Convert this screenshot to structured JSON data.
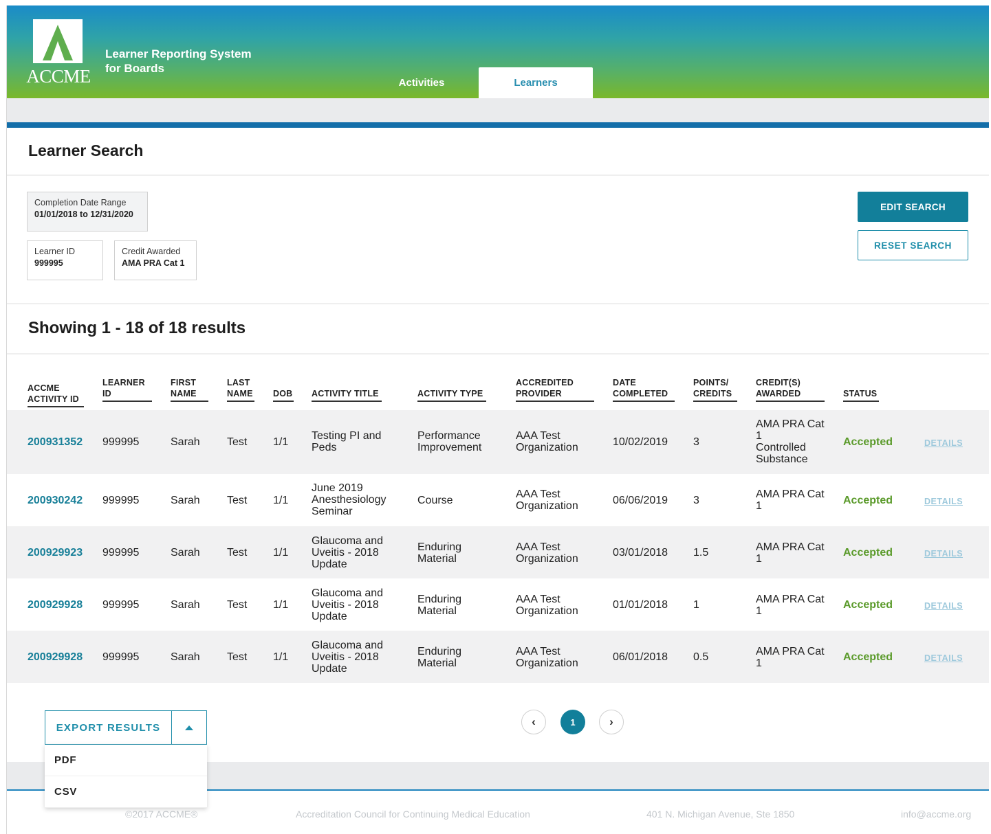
{
  "header": {
    "logo_text": "ACCME",
    "brand_line1": "Learner Reporting System",
    "brand_line2": "for Boards",
    "tabs": [
      {
        "label": "Activities"
      },
      {
        "label": "Learners"
      }
    ]
  },
  "page_title": "Learner Search",
  "filters": {
    "date_range_label": "Completion Date Range",
    "date_range_value": "01/01/2018 to 12/31/2020",
    "learner_id_label": "Learner ID",
    "learner_id_value": "999995",
    "credit_label": "Credit Awarded",
    "credit_value": "AMA PRA Cat 1"
  },
  "buttons": {
    "edit_search": "EDIT SEARCH",
    "reset_search": "RESET SEARCH"
  },
  "results_title": "Showing 1 - 18 of 18 results",
  "table": {
    "headers": {
      "accme_id_1": "ACCME",
      "accme_id_2": "ACTIVITY ID",
      "learner_id_1": "LEARNER",
      "learner_id_2": "ID",
      "first_1": "FIRST",
      "first_2": "NAME",
      "last_1": "LAST",
      "last_2": "NAME",
      "dob": "DOB",
      "title": "ACTIVITY TITLE",
      "type": "ACTIVITY TYPE",
      "provider_1": "ACCREDITED",
      "provider_2": "PROVIDER",
      "date_1": "DATE",
      "date_2": "COMPLETED",
      "points_1": "POINTS/",
      "points_2": "CREDITS",
      "credits_1": "CREDIT(S)",
      "credits_2": "AWARDED",
      "status": "STATUS"
    },
    "rows": [
      {
        "id": "200931352",
        "learner": "999995",
        "first": "Sarah",
        "last": "Test",
        "dob": "1/1",
        "title": [
          "Testing PI and",
          "Peds"
        ],
        "type": [
          "Performance",
          "Improvement"
        ],
        "provider": [
          "AAA Test",
          "Organization"
        ],
        "date": "10/02/2019",
        "points": "3",
        "credits": [
          "AMA PRA Cat",
          "1",
          "Controlled",
          "Substance"
        ],
        "status": "Accepted",
        "details": "DETAILS"
      },
      {
        "id": "200930242",
        "learner": "999995",
        "first": "Sarah",
        "last": "Test",
        "dob": "1/1",
        "title": [
          "June 2019",
          "Anesthesiology",
          "Seminar"
        ],
        "type": [
          "Course"
        ],
        "provider": [
          "AAA Test",
          "Organization"
        ],
        "date": "06/06/2019",
        "points": "3",
        "credits": [
          "AMA PRA Cat",
          "1"
        ],
        "status": "Accepted",
        "details": "DETAILS"
      },
      {
        "id": "200929923",
        "learner": "999995",
        "first": "Sarah",
        "last": "Test",
        "dob": "1/1",
        "title": [
          "Glaucoma and",
          "Uveitis - 2018",
          "Update"
        ],
        "type": [
          "Enduring",
          "Material"
        ],
        "provider": [
          "AAA Test",
          "Organization"
        ],
        "date": "03/01/2018",
        "points": "1.5",
        "credits": [
          "AMA PRA Cat",
          "1"
        ],
        "status": "Accepted",
        "details": "DETAILS"
      },
      {
        "id": "200929928",
        "learner": "999995",
        "first": "Sarah",
        "last": "Test",
        "dob": "1/1",
        "title": [
          "Glaucoma and",
          "Uveitis - 2018",
          "Update"
        ],
        "type": [
          "Enduring",
          "Material"
        ],
        "provider": [
          "AAA Test",
          "Organization"
        ],
        "date": "01/01/2018",
        "points": "1",
        "credits": [
          "AMA PRA Cat",
          "1"
        ],
        "status": "Accepted",
        "details": "DETAILS"
      },
      {
        "id": "200929928",
        "learner": "999995",
        "first": "Sarah",
        "last": "Test",
        "dob": "1/1",
        "title": [
          "Glaucoma and",
          "Uveitis - 2018",
          "Update"
        ],
        "type": [
          "Enduring",
          "Material"
        ],
        "provider": [
          "AAA Test",
          "Organization"
        ],
        "date": "06/01/2018",
        "points": "0.5",
        "credits": [
          "AMA PRA Cat",
          "1"
        ],
        "status": "Accepted",
        "details": "DETAILS"
      }
    ]
  },
  "export": {
    "label": "EXPORT RESULTS",
    "options": [
      "PDF",
      "CSV"
    ]
  },
  "pagination": {
    "prev": "‹",
    "current": "1",
    "next": "›"
  },
  "footer": {
    "copyright": "©2017 ACCME®",
    "org": "Accreditation Council for Continuing Medical Education",
    "address": "401 N. Michigan Avenue, Ste 1850",
    "email": "info@accme.org"
  },
  "colors": {
    "accent": "#127f9a",
    "status_accepted": "#5a9a2a",
    "header_top": "#1a8bc8",
    "header_bottom": "#7ab82a"
  }
}
